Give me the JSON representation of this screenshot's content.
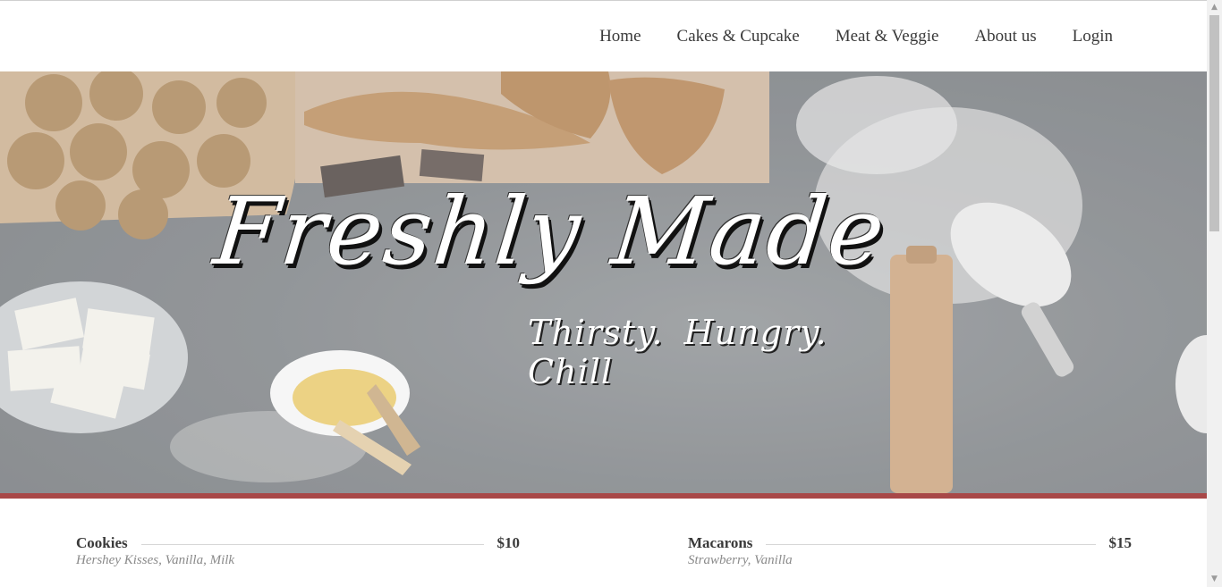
{
  "nav": {
    "items": [
      {
        "label": "Home"
      },
      {
        "label": "Cakes & Cupcake"
      },
      {
        "label": "Meat & Veggie"
      },
      {
        "label": "About us"
      },
      {
        "label": "Login"
      }
    ]
  },
  "hero": {
    "title": "Freshly Made",
    "tagline": "Thirsty. Hungry.  Chill"
  },
  "menu": {
    "items": [
      {
        "name": "Cookies",
        "price": "$10",
        "description": "Hershey Kisses, Vanilla, Milk"
      },
      {
        "name": "Macarons",
        "price": "$15",
        "description": "Strawberry, Vanilla"
      }
    ]
  },
  "colors": {
    "accent": "#a84848",
    "nav_text": "#3a3a3a",
    "description_text": "#8a8a8a"
  }
}
